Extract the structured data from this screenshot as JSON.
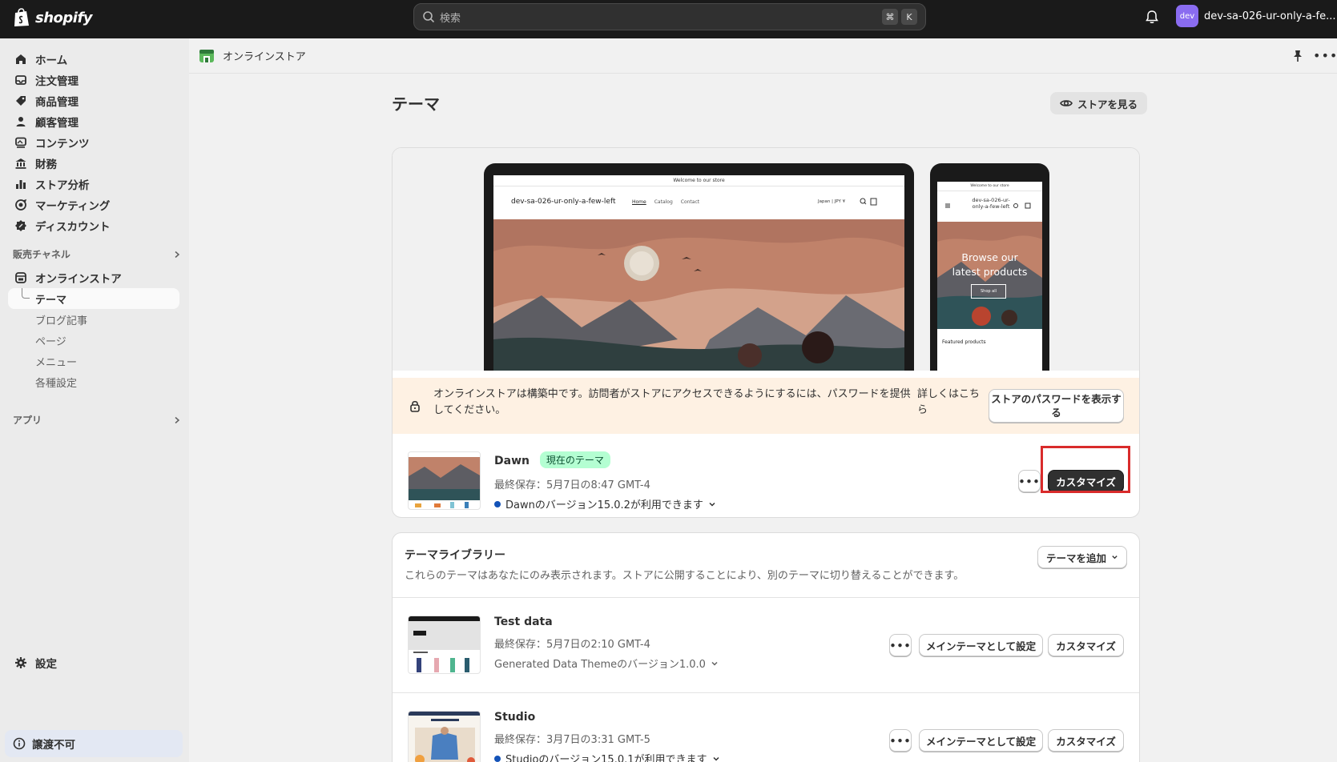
{
  "topbar": {
    "logo_text": "shopify",
    "search_placeholder": "検索",
    "shortcut_cmd": "⌘",
    "shortcut_key": "K",
    "store_avatar": "dev",
    "store_name": "dev-sa-026-ur-only-a-fe..."
  },
  "sidebar": {
    "items": [
      {
        "label": "ホーム",
        "icon": "home-icon"
      },
      {
        "label": "注文管理",
        "icon": "inbox-icon"
      },
      {
        "label": "商品管理",
        "icon": "tag-icon"
      },
      {
        "label": "顧客管理",
        "icon": "person-icon"
      },
      {
        "label": "コンテンツ",
        "icon": "image-icon"
      },
      {
        "label": "財務",
        "icon": "bank-icon"
      },
      {
        "label": "ストア分析",
        "icon": "chart-icon"
      },
      {
        "label": "マーケティング",
        "icon": "target-icon"
      },
      {
        "label": "ディスカウント",
        "icon": "discount-icon"
      }
    ],
    "sales_channels_label": "販売チャネル",
    "online_store_label": "オンラインストア",
    "sub_items": [
      "テーマ",
      "ブログ記事",
      "ページ",
      "メニュー",
      "各種設定"
    ],
    "apps_label": "アプリ",
    "settings_label": "設定",
    "transfer_label": "譲渡不可"
  },
  "breadcrumb": {
    "label": "オンラインストア"
  },
  "page": {
    "title": "テーマ",
    "view_store_label": "ストアを見る"
  },
  "preview": {
    "announcement": "Welcome to our store",
    "store_name": "dev-sa-026-ur-only-a-few-left",
    "phone_store_name": "dev-sa-026-ur-only-a-few-left",
    "nav": [
      "Home",
      "Catalog",
      "Contact"
    ],
    "locale": "Japan | JPY ¥",
    "hero_text_1": "Browse our",
    "hero_text_2": "latest products",
    "shop_all": "Shop all",
    "featured": "Featured products"
  },
  "notice": {
    "text": "オンラインストアは構築中です。訪問者がストアにアクセスできるようにするには、パスワードを提供してください。",
    "link": "詳しくはこちら",
    "button": "ストアのパスワードを表示する"
  },
  "current_theme": {
    "name": "Dawn",
    "badge": "現在のテーマ",
    "saved": "最終保存：5月7日の8:47 GMT-4",
    "version": "Dawnのバージョン15.0.2が利用できます",
    "more": "•••",
    "customize": "カスタマイズ"
  },
  "library": {
    "title": "テーマライブラリー",
    "subtitle": "これらのテーマはあなたにのみ表示されます。ストアに公開することにより、別のテーマに切り替えることができます。",
    "add_theme": "テーマを追加",
    "themes": [
      {
        "name": "Test data",
        "saved": "最終保存：5月7日の2:10 GMT-4",
        "version": "Generated Data Themeのバージョン1.0.0",
        "more": "•••",
        "publish": "メインテーマとして設定",
        "customize": "カスタマイズ"
      },
      {
        "name": "Studio",
        "saved": "最終保存：3月7日の3:31 GMT-5",
        "version": "Studioのバージョン15.0.1が利用できます",
        "more": "•••",
        "publish": "メインテーマとして設定",
        "customize": "カスタマイズ"
      }
    ]
  },
  "colors": {
    "topbar": "#1a1a1a",
    "sidebar": "#ebebeb",
    "accent_badge": "#b4fed2",
    "notice_bg": "#fef1e3",
    "highlight": "#d92b2b"
  }
}
